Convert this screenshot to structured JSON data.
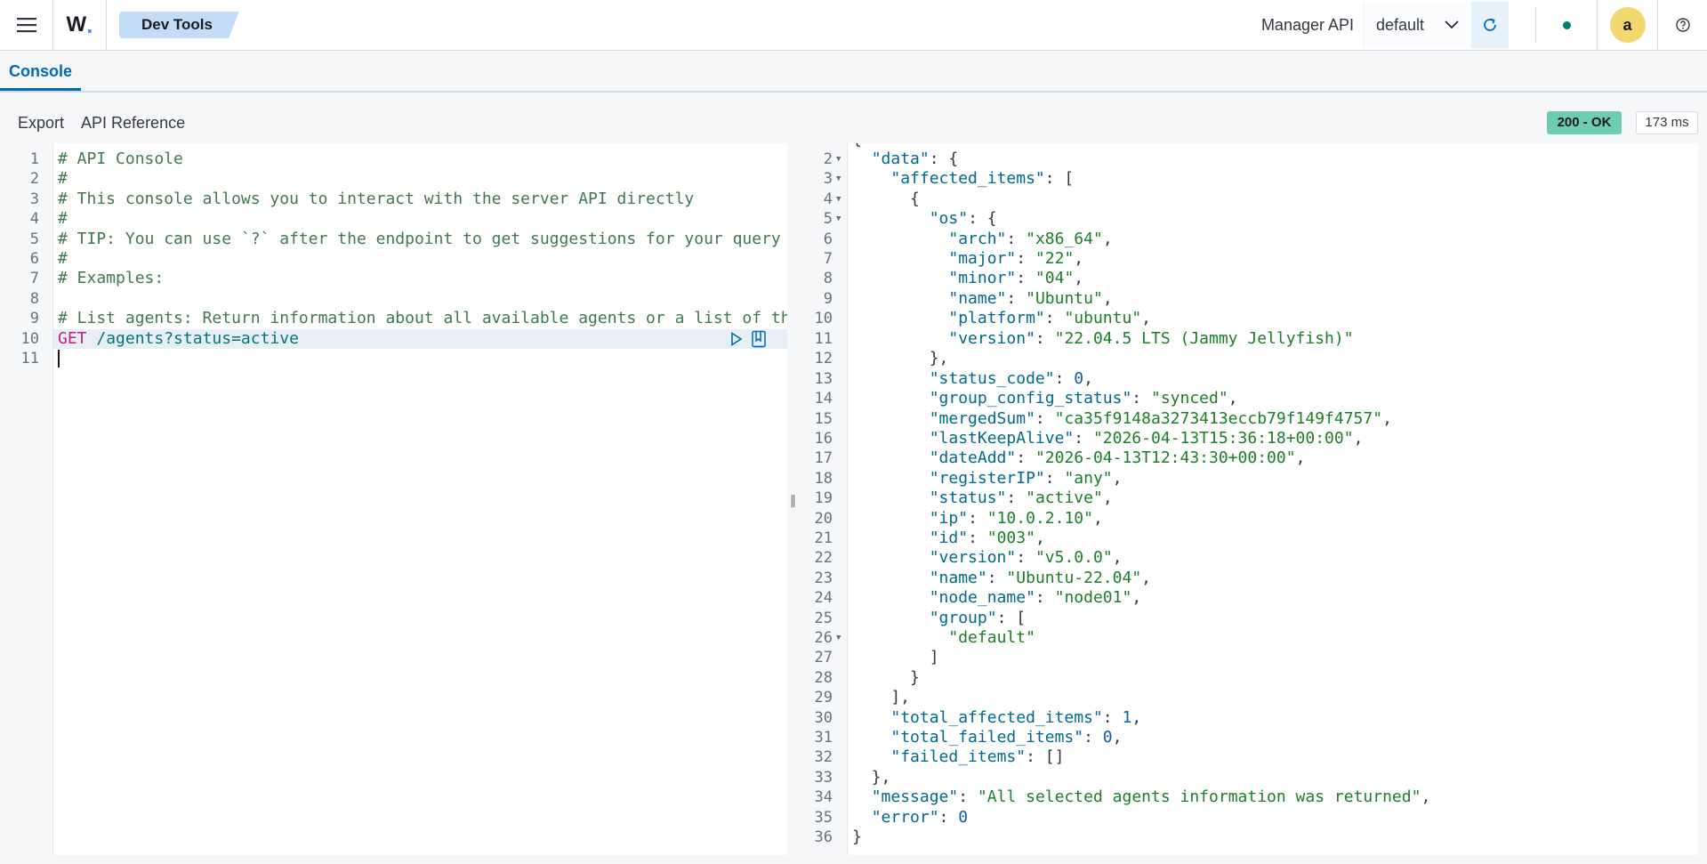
{
  "header": {
    "logo_text": "W",
    "logo_dot": ".",
    "breadcrumb": "Dev Tools",
    "api_label": "Manager API",
    "api_select_value": "default",
    "avatar_letter": "a",
    "icons": [
      "menu-icon",
      "chevron-down-icon",
      "refresh-icon",
      "status-dot-icon",
      "help-icon"
    ],
    "colors": {
      "accent": "#006bb8",
      "status_dot": "#017d73",
      "avatar": "#f1d86f",
      "ok_badge": "#6dccb1"
    }
  },
  "tabs": [
    {
      "label": "Console",
      "active": true
    }
  ],
  "toolbar": {
    "export_label": "Export",
    "api_reference_label": "API Reference",
    "status_badge": "200 - OK",
    "time_badge": "173 ms"
  },
  "request_editor": {
    "line_numbers": [
      "1",
      "2",
      "3",
      "4",
      "5",
      "6",
      "7",
      "8",
      "9",
      "10",
      "11"
    ],
    "lines": [
      "# API Console",
      "#",
      "# This console allows you to interact with the server API directly",
      "#",
      "# TIP: You can use `?` after the endpoint to get suggestions for your query pa",
      "#",
      "# Examples:",
      "",
      "# List agents: Return information about all available agents or a list of them"
    ],
    "request_method": "GET",
    "request_path": "/agents?status=active"
  },
  "response_editor": {
    "line_numbers": [
      "2",
      "3",
      "4",
      "5",
      "6",
      "7",
      "8",
      "9",
      "10",
      "11",
      "12",
      "13",
      "14",
      "15",
      "16",
      "17",
      "18",
      "19",
      "20",
      "21",
      "22",
      "23",
      "24",
      "25",
      "26",
      "27",
      "28",
      "29",
      "30",
      "31",
      "32",
      "33",
      "34",
      "35",
      "36"
    ],
    "fold_lines": [
      "2",
      "3",
      "4",
      "5",
      "25"
    ],
    "json": {
      "arch": "x86_64",
      "major": "22",
      "minor": "04",
      "os_name": "Ubuntu",
      "platform": "ubuntu",
      "os_version": "22.04.5 LTS (Jammy Jellyfish)",
      "status_code": "0",
      "group_config_status": "synced",
      "mergedSum": "ca35f9148a3273413eccb79f149f4757",
      "lastKeepAlive": "2026-04-13T15:36:18+00:00",
      "dateAdd": "2026-04-13T12:43:30+00:00",
      "registerIP": "any",
      "status": "active",
      "ip": "10.0.2.10",
      "id": "003",
      "version": "v5.0.0",
      "name": "Ubuntu-22.04",
      "node_name": "node01",
      "group_0": "default",
      "total_affected_items": "1",
      "total_failed_items": "0",
      "message": "All selected agents information was returned",
      "error": "0"
    }
  }
}
